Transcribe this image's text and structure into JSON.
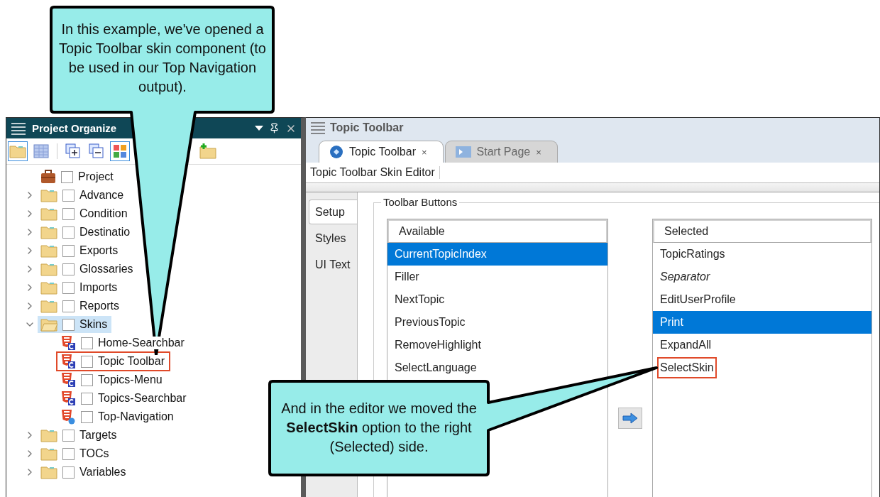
{
  "callouts": [
    {
      "kind": "top",
      "text": "In this example, we've opened a Topic Toolbar skin component (to be used in our Top Navigation output)."
    },
    {
      "kind": "bottom",
      "text": "And in the editor we moved the **SelectSkin** option to the right (Selected) side."
    }
  ],
  "project_organizer": {
    "title": "Project Organize",
    "tree": [
      {
        "label": "Project",
        "kind": "project",
        "selected": false,
        "outlined": false
      },
      {
        "label": "Advance",
        "kind": "folder",
        "expanded": false,
        "selected": false,
        "outlined": false
      },
      {
        "label": "Condition",
        "kind": "folder",
        "expanded": false,
        "selected": false,
        "outlined": false
      },
      {
        "label": "Destinatio",
        "kind": "folder",
        "expanded": false,
        "selected": false,
        "outlined": false
      },
      {
        "label": "Exports",
        "kind": "folder",
        "expanded": false,
        "selected": false,
        "outlined": false
      },
      {
        "label": "Glossaries",
        "kind": "folder",
        "expanded": false,
        "selected": false,
        "outlined": false
      },
      {
        "label": "Imports",
        "kind": "folder",
        "expanded": false,
        "selected": false,
        "outlined": false
      },
      {
        "label": "Reports",
        "kind": "folder",
        "expanded": false,
        "selected": false,
        "outlined": false
      },
      {
        "label": "Skins",
        "kind": "folder",
        "expanded": true,
        "selected": true,
        "outlined": false,
        "children": [
          {
            "label": "Home-Searchbar",
            "kind": "component",
            "selected": false,
            "outlined": false
          },
          {
            "label": "Topic Toolbar",
            "kind": "component",
            "selected": false,
            "outlined": true
          },
          {
            "label": "Topics-Menu",
            "kind": "component",
            "selected": false,
            "outlined": false
          },
          {
            "label": "Topics-Searchbar",
            "kind": "component",
            "selected": false,
            "outlined": false
          },
          {
            "label": "Top-Navigation",
            "kind": "skin",
            "selected": false,
            "outlined": false
          }
        ]
      },
      {
        "label": "Targets",
        "kind": "folder",
        "expanded": false,
        "selected": false,
        "outlined": false
      },
      {
        "label": "TOCs",
        "kind": "folder",
        "expanded": false,
        "selected": false,
        "outlined": false
      },
      {
        "label": "Variables",
        "kind": "folder",
        "expanded": false,
        "selected": false,
        "outlined": false
      }
    ]
  },
  "editor": {
    "title": "Topic Toolbar",
    "tabs": [
      {
        "label": "Topic Toolbar",
        "close": "×",
        "kind": "skin",
        "selected": true
      },
      {
        "label": "Start Page",
        "close": "×",
        "kind": "start",
        "selected": false
      }
    ],
    "editor_label": "Topic Toolbar Skin Editor",
    "side_tabs": [
      {
        "label": "Setup",
        "selected": true
      },
      {
        "label": "Styles",
        "selected": false
      },
      {
        "label": "UI Text",
        "selected": false
      }
    ],
    "group_title": "Toolbar Buttons",
    "available": {
      "header": "Available",
      "items": [
        {
          "label": "CurrentTopicIndex",
          "selected": true,
          "outlined": false
        },
        {
          "label": "Filler",
          "selected": false,
          "outlined": false
        },
        {
          "label": "NextTopic",
          "selected": false,
          "outlined": false
        },
        {
          "label": "PreviousTopic",
          "selected": false,
          "outlined": false
        },
        {
          "label": "RemoveHighlight",
          "selected": false,
          "outlined": false
        },
        {
          "label": "SelectLanguage",
          "selected": false,
          "outlined": false
        }
      ]
    },
    "selected_list": {
      "header": "Selected",
      "items": [
        {
          "label": "TopicRatings",
          "kind": "button",
          "selected": false,
          "outlined": false
        },
        {
          "label": "Separator",
          "kind": "separator",
          "selected": false,
          "outlined": false
        },
        {
          "label": "EditUserProfile",
          "kind": "button",
          "selected": false,
          "outlined": false
        },
        {
          "label": "Print",
          "kind": "button",
          "selected": true,
          "outlined": false
        },
        {
          "label": "ExpandAll",
          "kind": "button",
          "selected": false,
          "outlined": false
        },
        {
          "label": "SelectSkin",
          "kind": "button",
          "selected": false,
          "outlined": true
        }
      ]
    }
  }
}
